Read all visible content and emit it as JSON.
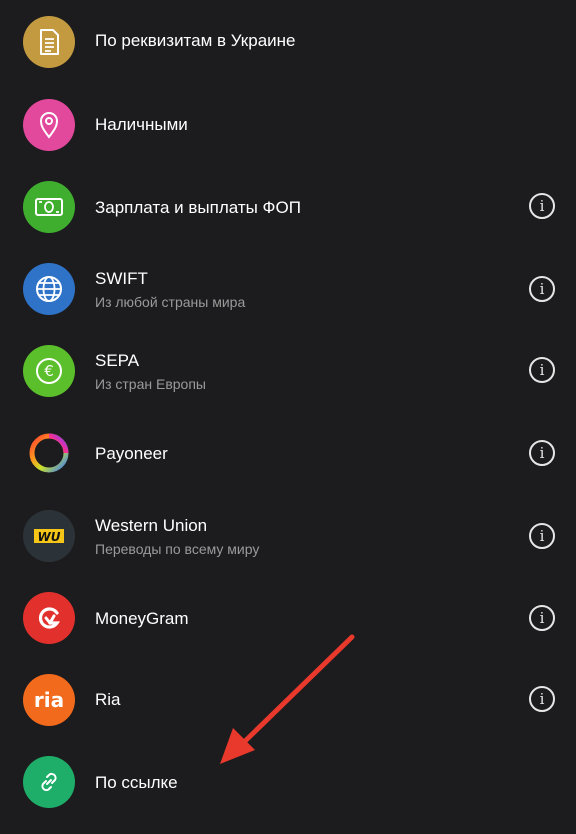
{
  "items": [
    {
      "title": "По реквизитам в Украине",
      "icon": "document-icon",
      "color": "#c39a3f",
      "info": false
    },
    {
      "title": "Наличными",
      "icon": "location-pin-icon",
      "color": "#e2489b",
      "info": false
    },
    {
      "title": "Зарплата и выплаты ФОП",
      "icon": "banknote-icon",
      "color": "#3fae2f",
      "info": true
    },
    {
      "title": "SWIFT",
      "subtitle": "Из любой страны мира",
      "icon": "globe-icon",
      "color": "#2f73c8",
      "info": true
    },
    {
      "title": "SEPA",
      "subtitle": "Из стран Европы",
      "icon": "euro-icon",
      "color": "#5bbf2c",
      "info": true
    },
    {
      "title": "Payoneer",
      "icon": "payoneer-ring-icon",
      "color": "#1c1c1e",
      "info": true
    },
    {
      "title": "Western Union",
      "subtitle": "Переводы по всему миру",
      "icon": "western-union-logo-icon",
      "color": "#2c3338",
      "info": true
    },
    {
      "title": "MoneyGram",
      "icon": "moneygram-logo-icon",
      "color": "#e2312c",
      "info": true
    },
    {
      "title": "Ria",
      "icon": "ria-logo-icon",
      "color": "#f26b1d",
      "info": true
    },
    {
      "title": "По ссылке",
      "icon": "link-icon",
      "color": "#1fae6a",
      "info": false
    }
  ],
  "info_glyph": "i",
  "logo_text": {
    "western_union": "WU",
    "ria": "ria"
  },
  "arrow_color": "#e8392c"
}
